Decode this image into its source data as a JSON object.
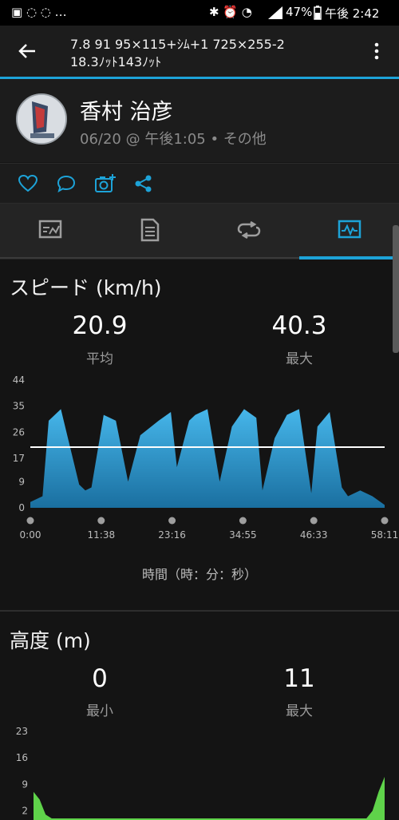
{
  "status_bar": {
    "left_icons": "▣ ◌ ◌ …",
    "right_icons": "✱ ⏰ ◔ ",
    "battery": "47%",
    "time": "午後 2:42"
  },
  "app_bar": {
    "title_line1": "7.8 91 95×115+ｼﾑ+1 725×255-2",
    "title_line2": "18.3ﾉｯﾄ143ﾉｯﾄ"
  },
  "activity": {
    "user_name": "香村 治彦",
    "meta": "06/20 @ 午後1:05 • その他"
  },
  "speed": {
    "title": "スピード (km/h)",
    "avg_value": "20.9",
    "avg_label": "平均",
    "max_value": "40.3",
    "max_label": "最大",
    "x_axis_label": "時間（時：分：秒）"
  },
  "elevation": {
    "title": "高度 (m)",
    "min_value": "0",
    "min_label": "最小",
    "max_value": "11",
    "max_label": "最大"
  },
  "colors": {
    "accent": "#1da3d8",
    "speed_fill": "#2a9fd6",
    "elevation_fill": "#5fd34a"
  },
  "chart_data": [
    {
      "type": "area",
      "yticks": [
        "44",
        "35",
        "26",
        "17",
        "9",
        "0"
      ],
      "ylim": [
        0,
        44
      ],
      "xticks": [
        "0:00",
        "11:38",
        "23:16",
        "34:55",
        "46:33",
        "58:11"
      ],
      "average_line": 20.9,
      "x": [
        0,
        2,
        3,
        5,
        8,
        9,
        10,
        12,
        14,
        16,
        18,
        21,
        23,
        24,
        26,
        27,
        29,
        31,
        33,
        35,
        37,
        38,
        40,
        42,
        44,
        46,
        47,
        49,
        51,
        52,
        54,
        56,
        58
      ],
      "values": [
        2,
        4,
        30,
        34,
        8,
        6,
        7,
        32,
        30,
        9,
        25,
        30,
        33,
        14,
        30,
        32,
        34,
        9,
        28,
        34,
        31,
        6,
        24,
        32,
        34,
        5,
        28,
        33,
        7,
        4,
        6,
        4,
        1
      ]
    },
    {
      "type": "area",
      "yticks": [
        "23",
        "16",
        "9",
        "2"
      ],
      "ylim": [
        0,
        23
      ],
      "x": [
        0,
        1,
        2,
        3,
        10,
        20,
        30,
        40,
        50,
        55,
        56,
        57,
        58
      ],
      "values": [
        7,
        5,
        1,
        0,
        0,
        0,
        0,
        0,
        0,
        0,
        2,
        7,
        11
      ]
    }
  ]
}
